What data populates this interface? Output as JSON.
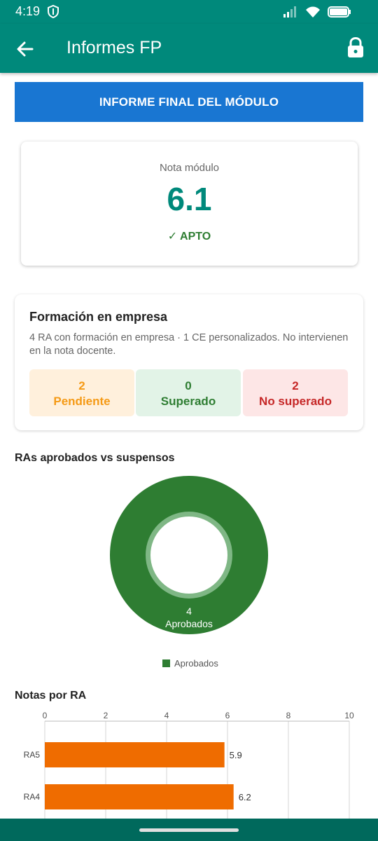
{
  "status": {
    "time": "4:19"
  },
  "appbar": {
    "title": "Informes FP"
  },
  "report_button": {
    "label": "INFORME FINAL DEL MÓDULO"
  },
  "grade": {
    "label": "Nota módulo",
    "value": "6.1",
    "status": "✓ APTO"
  },
  "fct": {
    "title": "Formación en empresa",
    "description": "4 RA con formación en empresa · 1 CE personalizados. No intervienen en la nota docente.",
    "boxes": [
      {
        "count": "2",
        "label": "Pendiente"
      },
      {
        "count": "0",
        "label": "Superado"
      },
      {
        "count": "2",
        "label": "No superado"
      }
    ]
  },
  "colors": {
    "primary": "#00897b",
    "accent_blue": "#1976d2",
    "approved": "#2e7d32",
    "bar": "#ef6c00"
  },
  "chart_data": [
    {
      "type": "pie",
      "title": "RAs aprobados vs suspensos",
      "slices": [
        {
          "label": "Aprobados",
          "value": 4
        }
      ],
      "center_label": "4",
      "slice_label": "Aprobados",
      "legend": [
        "Aprobados"
      ]
    },
    {
      "type": "bar",
      "orientation": "horizontal",
      "title": "Notas por RA",
      "categories": [
        "RA5",
        "RA4"
      ],
      "values": [
        5.9,
        6.2
      ],
      "value_labels": [
        "5.9",
        "6.2"
      ],
      "xlim": [
        0,
        10
      ],
      "xticks": [
        "0",
        "2",
        "4",
        "6",
        "8",
        "10"
      ],
      "grid": true
    }
  ]
}
